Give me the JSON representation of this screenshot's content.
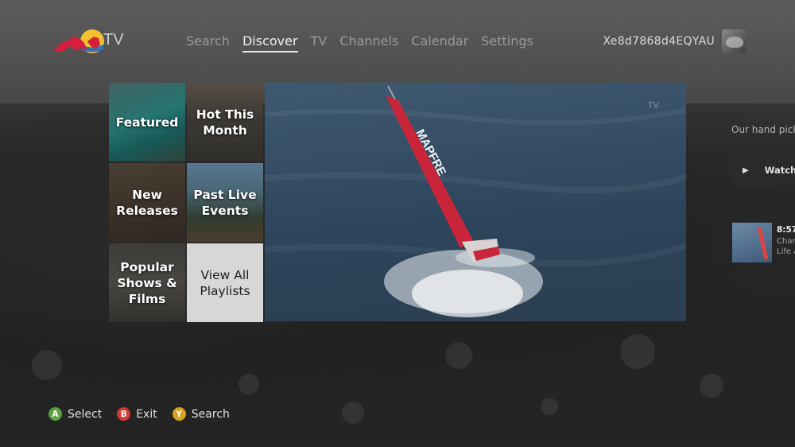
{
  "brand": {
    "logo_text": "TV"
  },
  "nav": {
    "items": [
      {
        "label": "Search",
        "active": false
      },
      {
        "label": "Discover",
        "active": true
      },
      {
        "label": "TV",
        "active": false
      },
      {
        "label": "Channels",
        "active": false
      },
      {
        "label": "Calendar",
        "active": false
      },
      {
        "label": "Settings",
        "active": false
      }
    ]
  },
  "user": {
    "gamertag": "Xe8d7868d4EQYAU"
  },
  "tiles": {
    "featured": "Featured",
    "hot": "Hot This Month",
    "new": "New Releases",
    "past": "Past Live Events",
    "popular": "Popular Shows & Films",
    "view_all": "View All Playlists"
  },
  "hero": {
    "sail_text": "MAPFRE",
    "watermark": "TV"
  },
  "peek": {
    "text": "Our hand pick",
    "watch_label": "Watch",
    "time": "8:57",
    "line1": "Char",
    "line2": "Life A"
  },
  "footer": {
    "hints": [
      {
        "key": "A",
        "label": "Select",
        "color": "#5aa23b"
      },
      {
        "key": "B",
        "label": "Exit",
        "color": "#cf3b33"
      },
      {
        "key": "Y",
        "label": "Search",
        "color": "#d8a21c"
      }
    ]
  },
  "colors": {
    "nav_active": "#f0f0f0",
    "nav_inactive": "#9a9a9a",
    "brand_red": "#d41f3f",
    "brand_yellow": "#f2c230",
    "sail_red": "#c8243a"
  }
}
